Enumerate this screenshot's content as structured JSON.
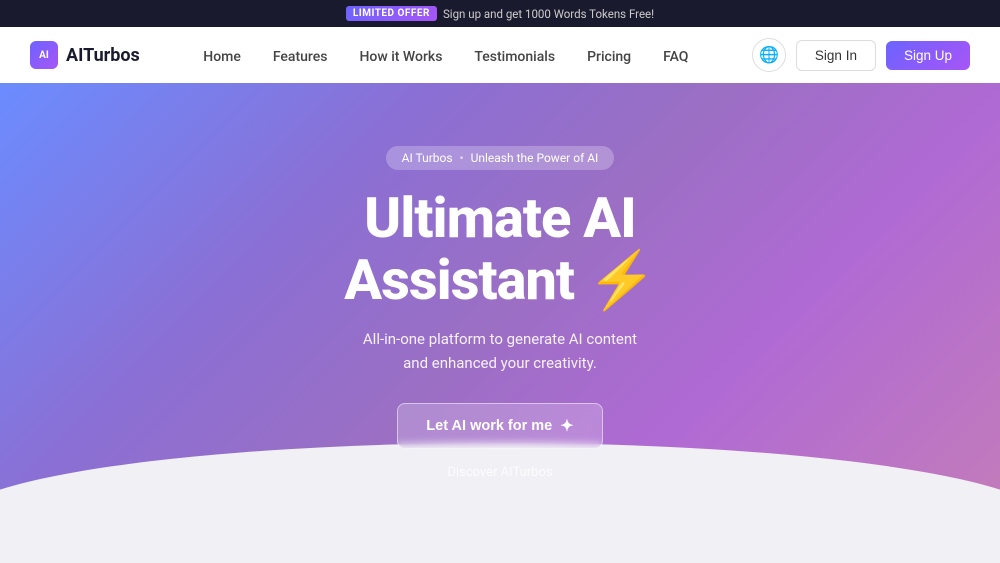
{
  "announcement": {
    "offer_label": "LIMITED OFFER",
    "offer_text": "Sign up and get 1000 Words Tokens Free!"
  },
  "navbar": {
    "logo_text": "AITurbos",
    "logo_icon_text": "AI",
    "nav_items": [
      {
        "label": "Home",
        "href": "#"
      },
      {
        "label": "Features",
        "href": "#"
      },
      {
        "label": "How it Works",
        "href": "#"
      },
      {
        "label": "Testimonials",
        "href": "#"
      },
      {
        "label": "Pricing",
        "href": "#"
      },
      {
        "label": "FAQ",
        "href": "#"
      }
    ],
    "signin_label": "Sign In",
    "signup_label": "Sign Up"
  },
  "hero": {
    "badge_brand": "AI Turbos",
    "badge_separator": "•",
    "badge_tagline": "Unleash the Power of AI",
    "title_line1": "Ultimate AI",
    "title_line2": "Assistant",
    "lightning": "⚡",
    "subtitle_line1": "All-in-one platform to generate AI content",
    "subtitle_line2": "and enhanced your creativity.",
    "cta_label": "Let AI work for me",
    "cta_arrow": "✦",
    "discover_label": "Discover AITurbos"
  }
}
